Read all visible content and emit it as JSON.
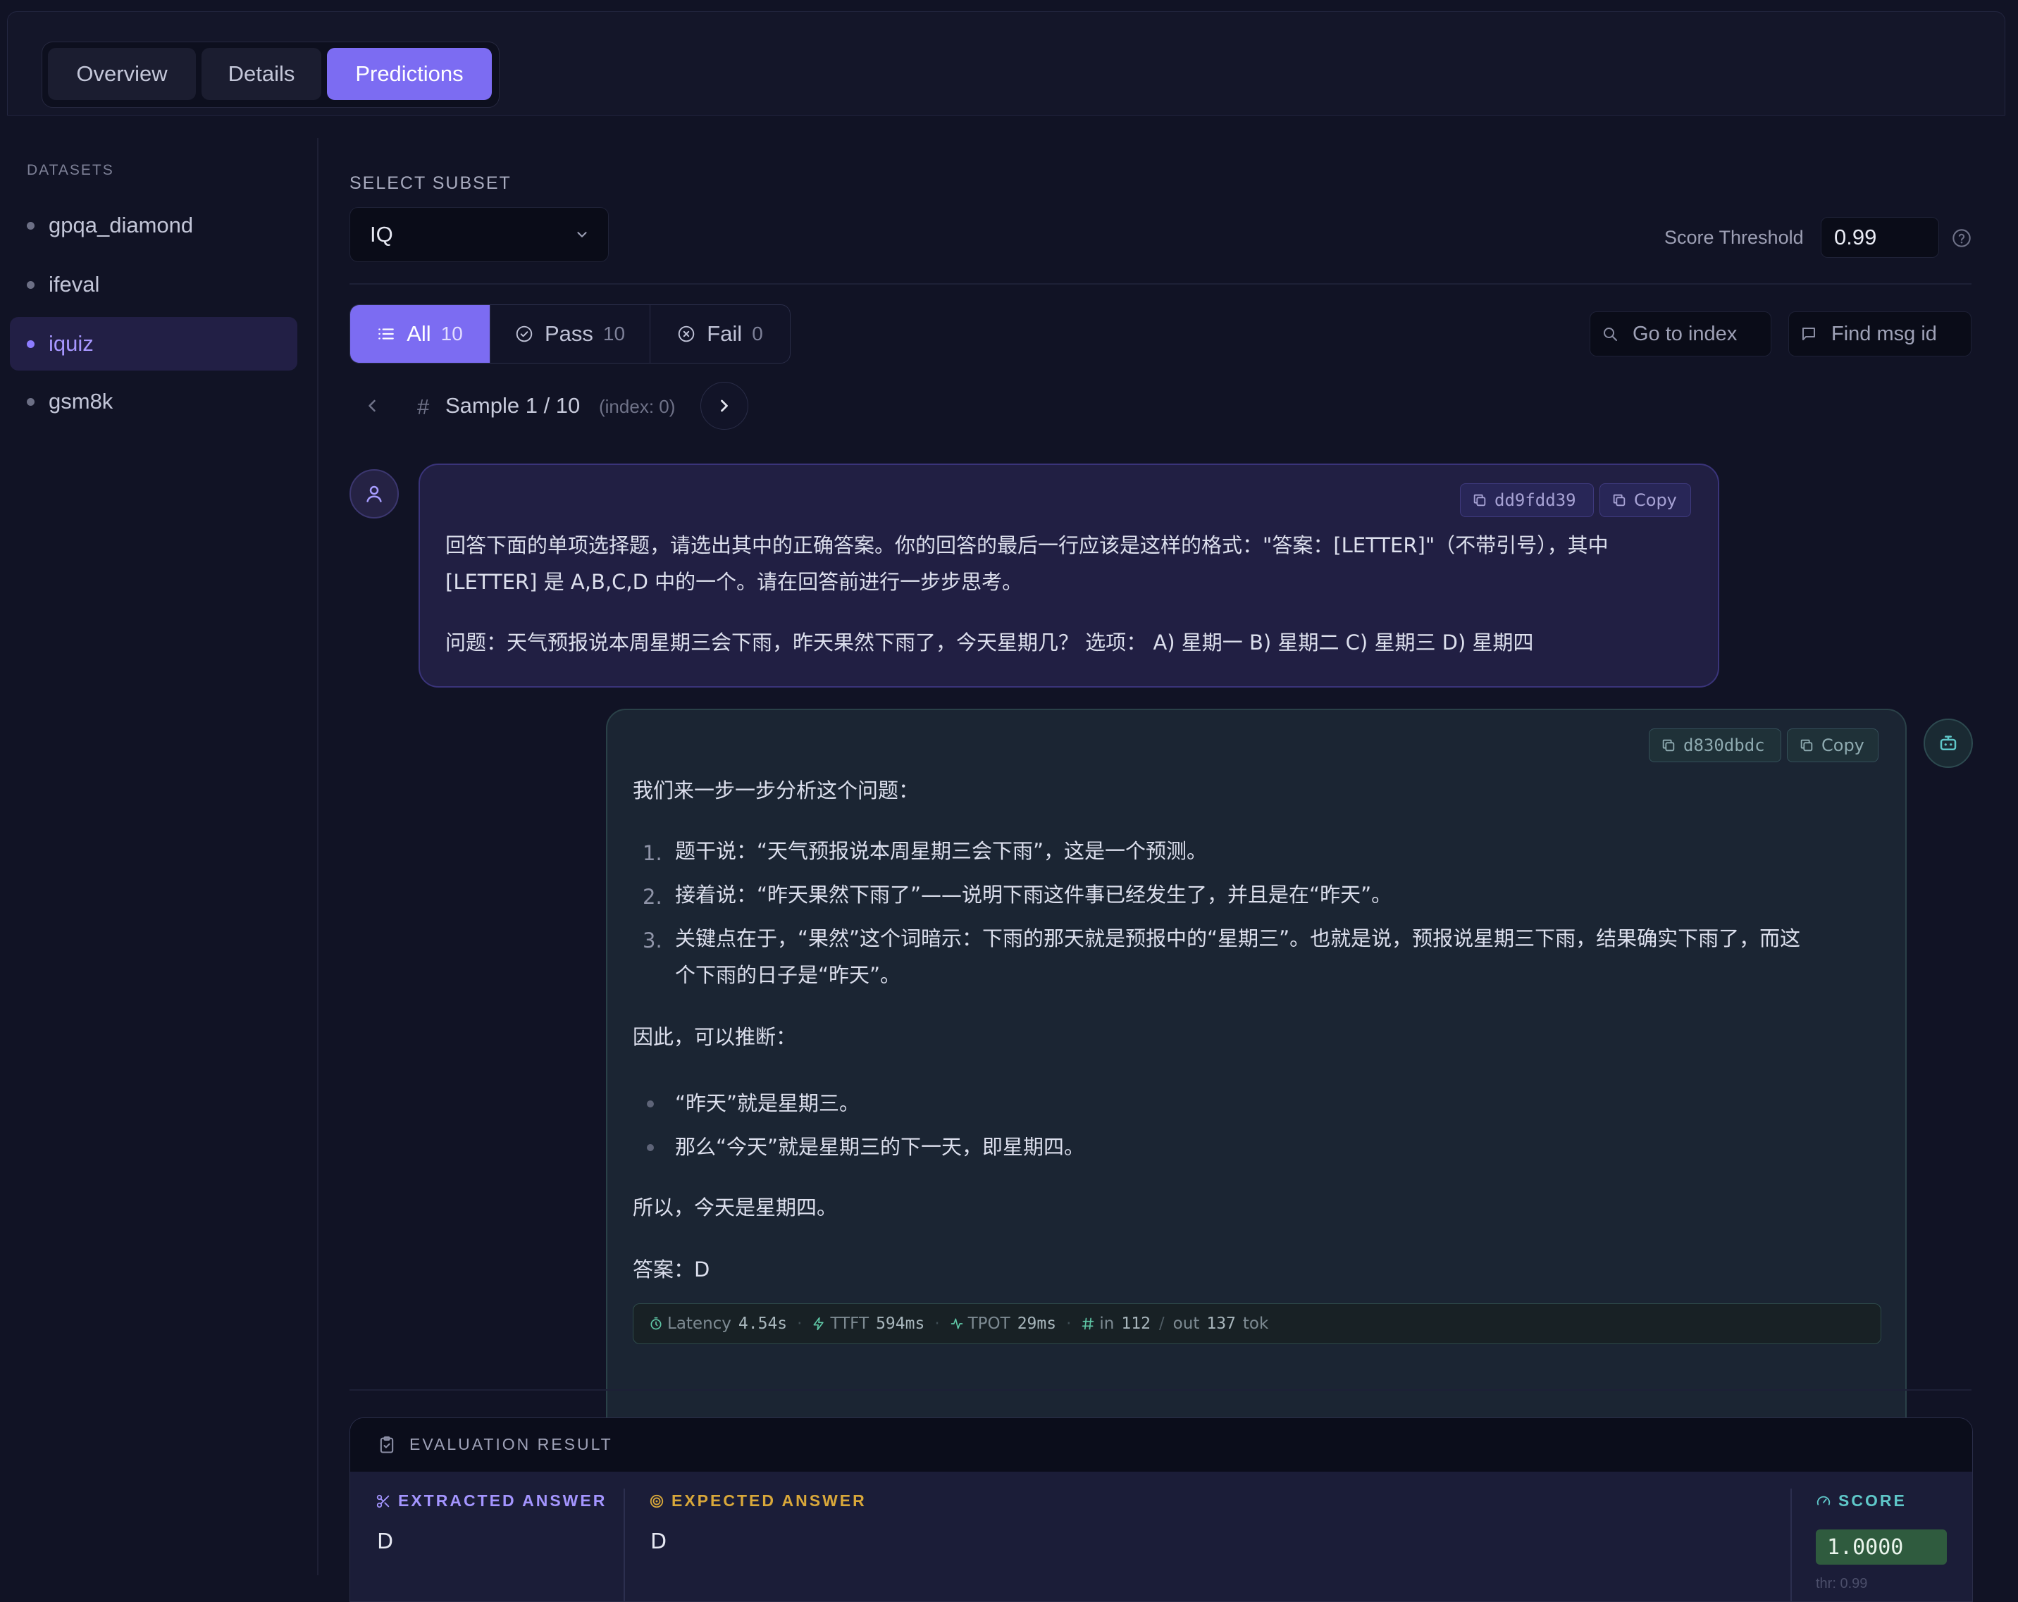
{
  "tabs": [
    {
      "label": "Overview",
      "active": false
    },
    {
      "label": "Details",
      "active": false
    },
    {
      "label": "Predictions",
      "active": true
    }
  ],
  "sidebar": {
    "heading": "DATASETS",
    "items": [
      {
        "label": "gpqa_diamond",
        "active": false
      },
      {
        "label": "ifeval",
        "active": false
      },
      {
        "label": "iquiz",
        "active": true
      },
      {
        "label": "gsm8k",
        "active": false
      }
    ]
  },
  "subset": {
    "label": "SELECT SUBSET",
    "value": "IQ",
    "icon": "chevron-down-icon"
  },
  "threshold": {
    "label": "Score Threshold",
    "value": "0.99",
    "help_icon": "help-circle-icon"
  },
  "filters": [
    {
      "label": "All",
      "count": "10",
      "icon": "list-icon",
      "active": true
    },
    {
      "label": "Pass",
      "count": "10",
      "icon": "check-circle-icon",
      "active": false
    },
    {
      "label": "Fail",
      "count": "0",
      "icon": "x-circle-icon",
      "active": false
    }
  ],
  "tools": {
    "goto_placeholder": "Go to index",
    "find_placeholder": "Find msg id"
  },
  "pager": {
    "hash": "#",
    "sample": "Sample 1 / 10",
    "index": "(index: 0)"
  },
  "messages": {
    "user": {
      "id": "dd9fdd39",
      "copy": "Copy",
      "lines": [
        "回答下面的单项选择题，请选出其中的正确答案。你的回答的最后一行应该是这样的格式：\"答案：[LETTER]\"（不带引号），其中",
        "[LETTER] 是 A,B,C,D 中的一个。请在回答前进行一步步思考。",
        "问题：天气预报说本周星期三会下雨，昨天果然下雨了，今天星期几？ 选项： A) 星期一 B) 星期二 C) 星期三 D) 星期四"
      ]
    },
    "assistant": {
      "id": "d830dbdc",
      "copy": "Copy",
      "intro": "我们来一步一步分析这个问题：",
      "ordered": [
        {
          "num": "1.",
          "lines": [
            "题干说：“天气预报说本周星期三会下雨”，这是一个预测。"
          ]
        },
        {
          "num": "2.",
          "lines": [
            "接着说：“昨天果然下雨了”——说明下雨这件事已经发生了，并且是在“昨天”。"
          ]
        },
        {
          "num": "3.",
          "lines": [
            "关键点在于，“果然”这个词暗示：下雨的那天就是预报中的“星期三”。也就是说，预报说星期三下雨，结果确实下雨了，而这",
            "个下雨的日子是“昨天”。"
          ]
        }
      ],
      "therefore": "因此，可以推断：",
      "bullets": [
        "“昨天”就是星期三。",
        "那么“今天”就是星期三的下一天，即星期四。"
      ],
      "conclusion": "所以，今天是星期四。",
      "answer": "答案：D",
      "stats": {
        "latency_label": "Latency",
        "latency": "4.54s",
        "ttft_label": "TTFT",
        "ttft": "594ms",
        "tpot_label": "TPOT",
        "tpot": "29ms",
        "in_label": "in",
        "in": "112",
        "slash": "/",
        "out_label": "out",
        "out": "137",
        "unit": "tok"
      }
    }
  },
  "evaluation": {
    "title": "EVALUATION RESULT",
    "extracted_label": "EXTRACTED ANSWER",
    "extracted": "D",
    "expected_label": "EXPECTED ANSWER",
    "expected": "D",
    "score_label": "SCORE",
    "score": "1.0000",
    "threshold_note": "thr: 0.99"
  },
  "colors": {
    "accent": "#7c6cf2",
    "background": "#111325",
    "user_bubble": "#211f43",
    "assistant_bubble": "#1b2533",
    "pass_score": "#2f5b3e",
    "expected_gold": "#d9a83a",
    "score_teal": "#5fc7c9"
  }
}
